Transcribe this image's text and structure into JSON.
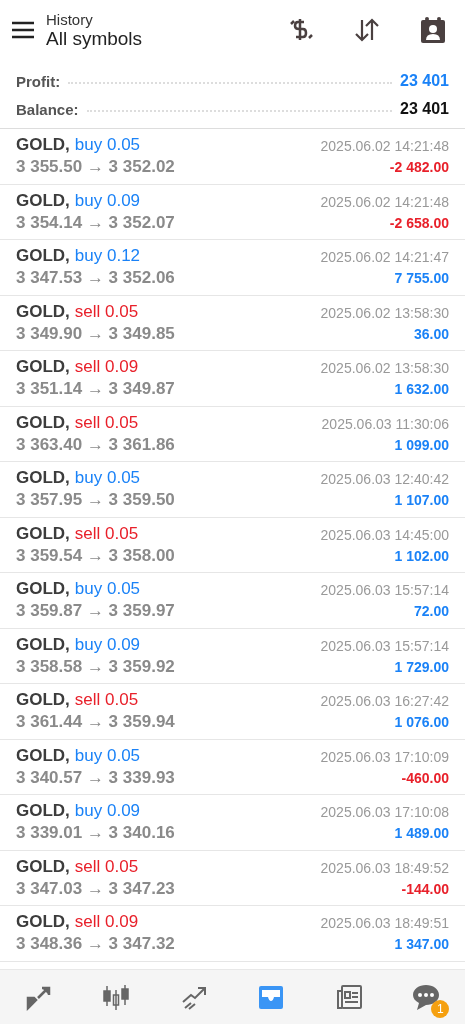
{
  "header": {
    "subtitle": "History",
    "title": "All symbols"
  },
  "summary": [
    {
      "label": "Profit:",
      "value": "23 401",
      "kind": "profit"
    },
    {
      "label": "Balance:",
      "value": "23 401",
      "kind": "balance"
    }
  ],
  "deals": [
    {
      "symbol": "GOLD,",
      "kind": "buy",
      "action": "buy 0.05",
      "prices": "3 355.50 → 3 352.02",
      "time": "2025.06.02 14:21:48",
      "profit": "-2 482.00",
      "loss": true
    },
    {
      "symbol": "GOLD,",
      "kind": "buy",
      "action": "buy 0.09",
      "prices": "3 354.14 → 3 352.07",
      "time": "2025.06.02 14:21:48",
      "profit": "-2 658.00",
      "loss": true
    },
    {
      "symbol": "GOLD,",
      "kind": "buy",
      "action": "buy 0.12",
      "prices": "3 347.53 → 3 352.06",
      "time": "2025.06.02 14:21:47",
      "profit": "7 755.00",
      "loss": false
    },
    {
      "symbol": "GOLD,",
      "kind": "sell",
      "action": "sell 0.05",
      "prices": "3 349.90 → 3 349.85",
      "time": "2025.06.02 13:58:30",
      "profit": "36.00",
      "loss": false
    },
    {
      "symbol": "GOLD,",
      "kind": "sell",
      "action": "sell 0.09",
      "prices": "3 351.14 → 3 349.87",
      "time": "2025.06.02 13:58:30",
      "profit": "1 632.00",
      "loss": false
    },
    {
      "symbol": "GOLD,",
      "kind": "sell",
      "action": "sell 0.05",
      "prices": "3 363.40 → 3 361.86",
      "time": "2025.06.03 11:30:06",
      "profit": "1 099.00",
      "loss": false
    },
    {
      "symbol": "GOLD,",
      "kind": "buy",
      "action": "buy 0.05",
      "prices": "3 357.95 → 3 359.50",
      "time": "2025.06.03 12:40:42",
      "profit": "1 107.00",
      "loss": false
    },
    {
      "symbol": "GOLD,",
      "kind": "sell",
      "action": "sell 0.05",
      "prices": "3 359.54 → 3 358.00",
      "time": "2025.06.03 14:45:00",
      "profit": "1 102.00",
      "loss": false
    },
    {
      "symbol": "GOLD,",
      "kind": "buy",
      "action": "buy 0.05",
      "prices": "3 359.87 → 3 359.97",
      "time": "2025.06.03 15:57:14",
      "profit": "72.00",
      "loss": false
    },
    {
      "symbol": "GOLD,",
      "kind": "buy",
      "action": "buy 0.09",
      "prices": "3 358.58 → 3 359.92",
      "time": "2025.06.03 15:57:14",
      "profit": "1 729.00",
      "loss": false
    },
    {
      "symbol": "GOLD,",
      "kind": "sell",
      "action": "sell 0.05",
      "prices": "3 361.44 → 3 359.94",
      "time": "2025.06.03 16:27:42",
      "profit": "1 076.00",
      "loss": false
    },
    {
      "symbol": "GOLD,",
      "kind": "buy",
      "action": "buy 0.05",
      "prices": "3 340.57 → 3 339.93",
      "time": "2025.06.03 17:10:09",
      "profit": "-460.00",
      "loss": true
    },
    {
      "symbol": "GOLD,",
      "kind": "buy",
      "action": "buy 0.09",
      "prices": "3 339.01 → 3 340.16",
      "time": "2025.06.03 17:10:08",
      "profit": "1 489.00",
      "loss": false
    },
    {
      "symbol": "GOLD,",
      "kind": "sell",
      "action": "sell 0.05",
      "prices": "3 347.03 → 3 347.23",
      "time": "2025.06.03 18:49:52",
      "profit": "-144.00",
      "loss": true
    },
    {
      "symbol": "GOLD,",
      "kind": "sell",
      "action": "sell 0.09",
      "prices": "3 348.36 → 3 347.32",
      "time": "2025.06.03 18:49:51",
      "profit": "1 347.00",
      "loss": false
    }
  ],
  "nav": [
    {
      "kind": "quotes",
      "selected": false
    },
    {
      "kind": "chart",
      "selected": false
    },
    {
      "kind": "trade",
      "selected": false
    },
    {
      "kind": "history",
      "selected": true
    },
    {
      "kind": "news",
      "selected": false
    },
    {
      "kind": "chat",
      "selected": false,
      "badge": "1"
    }
  ]
}
